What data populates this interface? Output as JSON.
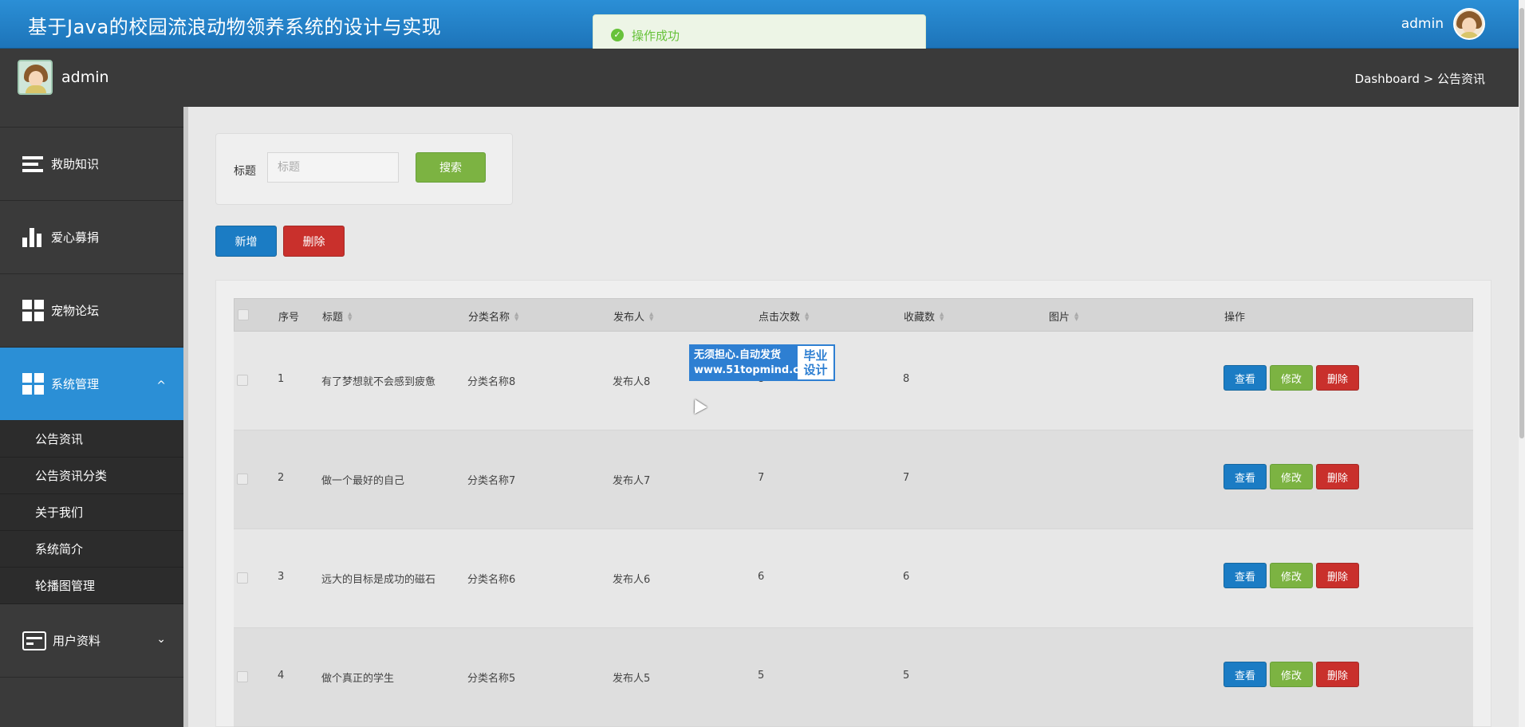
{
  "header": {
    "app_title": "基于Java的校园流浪动物领养系统的设计与实现",
    "user_name": "admin"
  },
  "toast": {
    "message": "操作成功"
  },
  "subbar": {
    "user_name": "admin",
    "breadcrumb": "Dashboard > 公告资讯"
  },
  "sidebar": {
    "items": [
      {
        "label": "救助知识",
        "icon": "list-icon"
      },
      {
        "label": "爱心募捐",
        "icon": "bar-chart-icon"
      },
      {
        "label": "宠物论坛",
        "icon": "grid-icon"
      },
      {
        "label": "系统管理",
        "icon": "grid-icon",
        "expanded": true,
        "caret": "^"
      },
      {
        "label": "用户资料",
        "icon": "id-card-icon",
        "expanded": false,
        "caret": "⌄"
      }
    ],
    "sub_items": [
      "公告资讯",
      "公告资讯分类",
      "关于我们",
      "系统简介",
      "轮播图管理"
    ]
  },
  "search": {
    "label": "标题",
    "placeholder": "标题",
    "value": "",
    "button_label": "搜索"
  },
  "actions": {
    "add_label": "新增",
    "delete_label": "删除"
  },
  "table": {
    "columns": [
      "序号",
      "标题",
      "分类名称",
      "发布人",
      "点击次数",
      "收藏数",
      "图片",
      "操作"
    ],
    "rows": [
      {
        "index": "1",
        "title": "有了梦想就不会感到疲惫",
        "category": "分类名称8",
        "publisher": "发布人8",
        "clicks": "8",
        "favorites": "8"
      },
      {
        "index": "2",
        "title": "做一个最好的自己",
        "category": "分类名称7",
        "publisher": "发布人7",
        "clicks": "7",
        "favorites": "7"
      },
      {
        "index": "3",
        "title": "远大的目标是成功的磁石",
        "category": "分类名称6",
        "publisher": "发布人6",
        "clicks": "6",
        "favorites": "6"
      },
      {
        "index": "4",
        "title": "做个真正的学生",
        "category": "分类名称5",
        "publisher": "发布人5",
        "clicks": "5",
        "favorites": "5"
      }
    ],
    "row_actions": {
      "view": "查看",
      "edit": "修改",
      "delete": "删除"
    }
  },
  "watermark": {
    "line1": "无须担心.自动发货",
    "line2": "www.51topmind.com",
    "right1": "毕业",
    "right2": "设计"
  },
  "colors": {
    "header_blue": "#1d74b9",
    "sidebar_dark": "#3a3a3a",
    "active_blue": "#2b8fd6",
    "success_green": "#67c23a",
    "btn_green": "#7cb342",
    "btn_blue": "#1b7cc4",
    "btn_red": "#c9302c"
  }
}
